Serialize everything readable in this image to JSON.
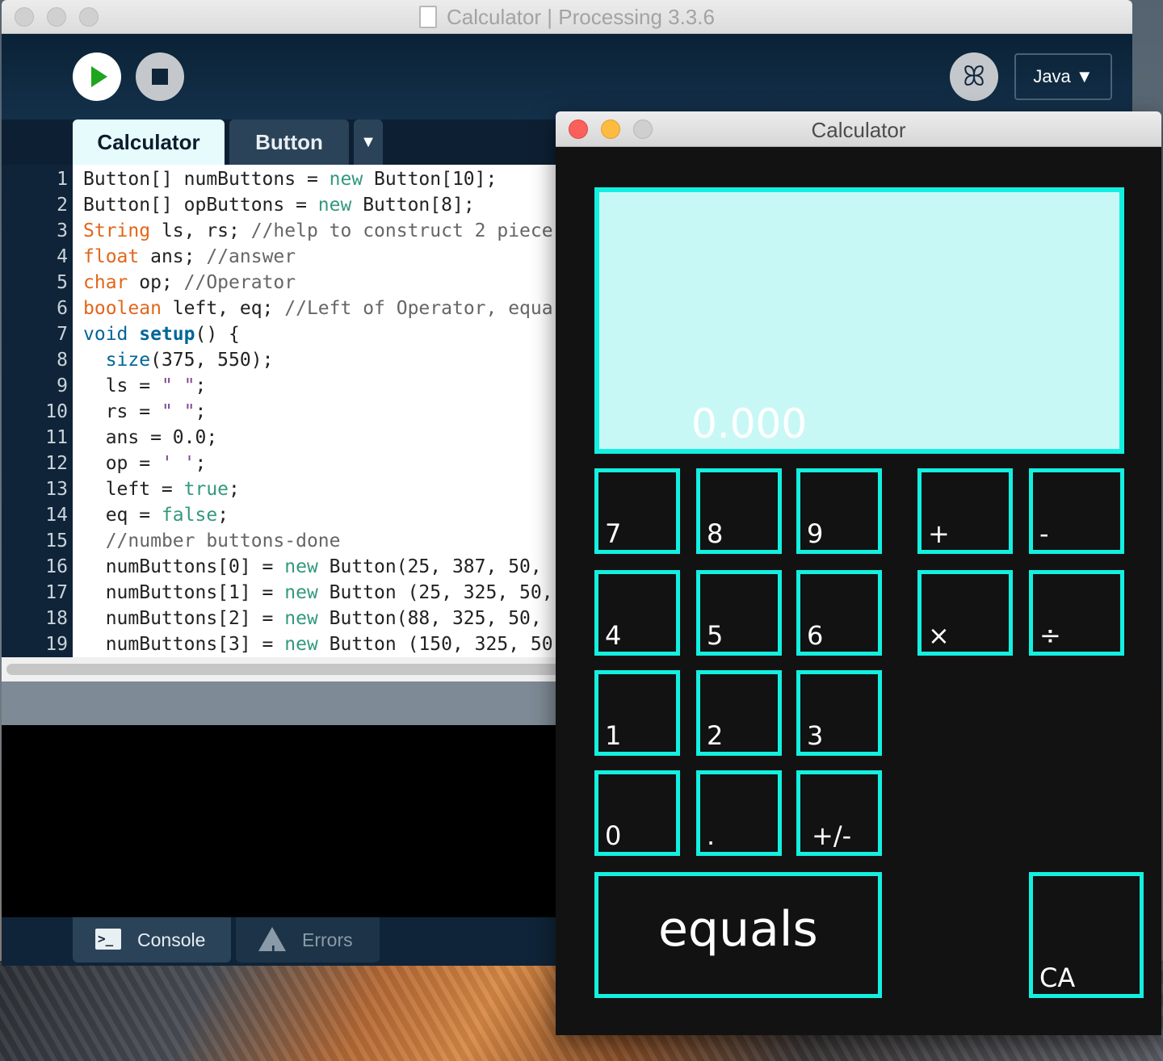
{
  "ide": {
    "title": "Calculator | Processing 3.3.6",
    "toolbar": {
      "run_icon": "play-icon",
      "stop_icon": "stop-icon",
      "debug_icon": "butterfly-icon",
      "debug_glyph": "ꕤ",
      "mode_label": "Java ▼"
    },
    "tabs": [
      {
        "label": "Calculator"
      },
      {
        "label": "Button"
      }
    ],
    "tab_menu_glyph": "▼",
    "footer": {
      "console_label": "Console",
      "console_glyph": ">_",
      "errors_label": "Errors",
      "errors_glyph": "!"
    }
  },
  "code": {
    "line_numbers": [
      "1",
      "2",
      "3",
      "4",
      "5",
      "6",
      "7",
      "8",
      "9",
      "10",
      "11",
      "12",
      "13",
      "14",
      "15",
      "16",
      "17",
      "18",
      "19"
    ],
    "l1": {
      "a": "Button[] numButtons = ",
      "b": "new",
      "c": " Button[10];"
    },
    "l2": {
      "a": "Button[] opButtons = ",
      "b": "new",
      "c": " Button[8];"
    },
    "l3": {
      "a": "String",
      "b": " ls, rs; ",
      "c": "//help to construct 2 piece"
    },
    "l4": {
      "a": "float",
      "b": " ans; ",
      "c": "//answer"
    },
    "l5": {
      "a": "char",
      "b": " op; ",
      "c": "//Operator"
    },
    "l6": {
      "a": "boolean",
      "b": " left, eq; ",
      "c": "//Left of Operator, equa"
    },
    "l7": {
      "a": "void ",
      "b": "setup",
      "c": "() {"
    },
    "l8": {
      "a": "  ",
      "b": "size",
      "c": "(375, 550);"
    },
    "l9": {
      "a": "  ls = ",
      "b": "\" \"",
      "c": ";"
    },
    "l10": {
      "a": "  rs = ",
      "b": "\" \"",
      "c": ";"
    },
    "l11": {
      "a": "  ans = 0.0;"
    },
    "l12": {
      "a": "  op = ",
      "b": "' '",
      "c": ";"
    },
    "l13": {
      "a": "  left = ",
      "b": "true",
      "c": ";"
    },
    "l14": {
      "a": "  eq = ",
      "b": "false",
      "c": ";"
    },
    "l15": {
      "a": "  ",
      "b": "//number buttons-done"
    },
    "l16": {
      "a": "  numButtons[0] = ",
      "b": "new",
      "c": " Button(25, 387, 50, "
    },
    "l17": {
      "a": "  numButtons[1] = ",
      "b": "new",
      "c": " Button (25, 325, 50,"
    },
    "l18": {
      "a": "  numButtons[2] = ",
      "b": "new",
      "c": " Button(88, 325, 50, "
    },
    "l19": {
      "a": "  numButtons[3] = ",
      "b": "new",
      "c": " Button (150, 325, 50"
    }
  },
  "calculator": {
    "title": "Calculator",
    "display_value": "0.000",
    "keys": {
      "k7": "7",
      "k8": "8",
      "k9": "9",
      "plus": "+",
      "minus": "-",
      "k4": "4",
      "k5": "5",
      "k6": "6",
      "times": "×",
      "divide": "÷",
      "k1": "1",
      "k2": "2",
      "k3": "3",
      "k0": "0",
      "dot": ".",
      "negate": "+/-",
      "equals": "equals",
      "clear_all": "CA"
    },
    "accent_color": "#14f0e0",
    "display_color": "#c8f8f5"
  }
}
